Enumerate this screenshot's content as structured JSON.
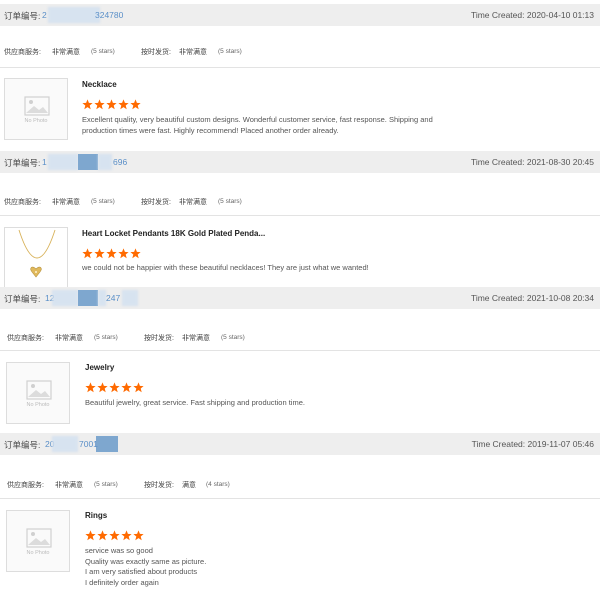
{
  "labels": {
    "order_no": "订单编号:",
    "time_created": "Time Created:",
    "supplier_service": "供应商服务:",
    "on_time_shipping": "按时发货:",
    "no_photo": "No Photo"
  },
  "colors": {
    "star": "#ff6a00",
    "order_number": "#5a8fc8",
    "bar_bg": "#eeeeee"
  },
  "orders": [
    {
      "order_prefix": "2",
      "order_suffix": "324780",
      "time": "2020-04-10 01:13",
      "supplier_rating": "非常满意",
      "supplier_stars": "(5 stars)",
      "shipping_rating": "非常满意",
      "shipping_stars": "(5 stars)",
      "product": "Necklace",
      "image": "no-photo",
      "stars": 5,
      "review_lines": [
        "Excellent quality, very beautiful custom designs. Wonderful customer service, fast response. Shipping and",
        "production times were fast. Highly recommend! Placed another order already."
      ]
    },
    {
      "order_prefix": "1",
      "order_suffix": "696",
      "time": "2021-08-30 20:45",
      "supplier_rating": "非常满意",
      "supplier_stars": "(5 stars)",
      "shipping_rating": "非常满意",
      "shipping_stars": "(5 stars)",
      "product": "Heart Locket Pendants 18K Gold Plated Penda...",
      "image": "heart-necklace",
      "stars": 5,
      "review_lines": [
        "we could not be happier with these beautiful necklaces! They are just what we wanted!"
      ]
    },
    {
      "order_prefix": "12",
      "order_suffix": "247",
      "time": "2021-10-08 20:34",
      "supplier_rating": "非常满意",
      "supplier_stars": "(5 stars)",
      "shipping_rating": "非常满意",
      "shipping_stars": "(5 stars)",
      "product": "Jewelry",
      "image": "no-photo",
      "stars": 5,
      "review_lines": [
        "Beautiful jewelry, great service. Fast shipping and production time."
      ]
    },
    {
      "order_prefix": "20",
      "order_suffix": "7001",
      "time": "2019-11-07 05:46",
      "supplier_rating": "非常满意",
      "supplier_stars": "(5 stars)",
      "shipping_rating": "满意",
      "shipping_stars": "(4 stars)",
      "product": "Rings",
      "image": "no-photo",
      "stars": 5,
      "review_lines": [
        "service was so good",
        "Quality was exactly same as picture.",
        "I am very satisfied about products",
        "I definitely order again"
      ]
    }
  ]
}
